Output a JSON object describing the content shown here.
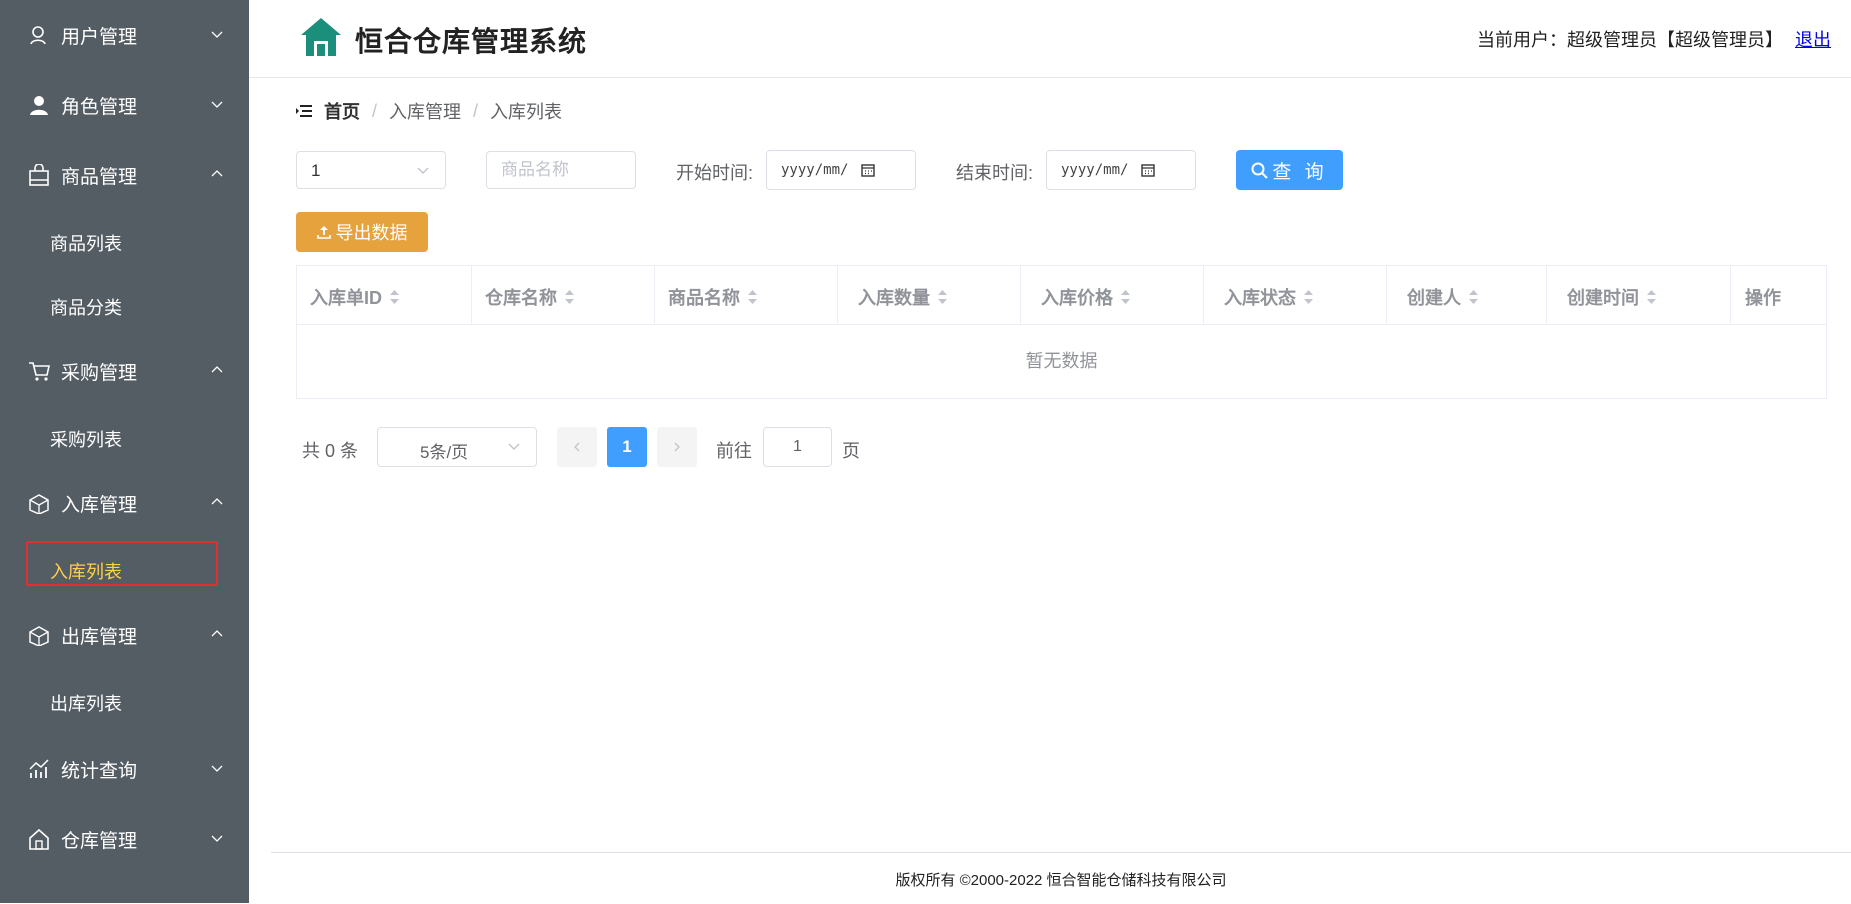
{
  "sidebar": {
    "menus": [
      {
        "label": "用户管理",
        "icon": "user-outline-icon",
        "expanded": false
      },
      {
        "label": "角色管理",
        "icon": "user-solid-icon",
        "expanded": false
      },
      {
        "label": "商品管理",
        "icon": "shopping-bag-icon",
        "expanded": true,
        "children": [
          "商品列表",
          "商品分类"
        ]
      },
      {
        "label": "采购管理",
        "icon": "cart-icon",
        "expanded": true,
        "children": [
          "采购列表"
        ]
      },
      {
        "label": "入库管理",
        "icon": "box-in-icon",
        "expanded": true,
        "children": [
          "入库列表"
        ]
      },
      {
        "label": "出库管理",
        "icon": "box-out-icon",
        "expanded": true,
        "children": [
          "出库列表"
        ]
      },
      {
        "label": "统计查询",
        "icon": "chart-icon",
        "expanded": false
      },
      {
        "label": "仓库管理",
        "icon": "warehouse-icon",
        "expanded": false
      }
    ],
    "active_item": "入库列表",
    "colors": {
      "bg": "#545c64",
      "text": "#ffffff",
      "active": "#ffd04b",
      "highlight_box": "#e03131"
    }
  },
  "header": {
    "title": "恒合仓库管理系统",
    "user_label": "当前用户：超级管理员【超级管理员】",
    "logout": "退出",
    "logo_color": "#1b8f7c"
  },
  "breadcrumb": {
    "home": "首页",
    "level1": "入库管理",
    "level2": "入库列表"
  },
  "filters": {
    "warehouse_value": "1",
    "name_placeholder": "商品名称",
    "start_label": "开始时间:",
    "start_value": "yyyy/mm/",
    "end_label": "结束时间:",
    "end_value": "yyyy/mm/",
    "query_label": "查 询"
  },
  "export_label": "导出数据",
  "table": {
    "columns": [
      "入库单ID",
      "仓库名称",
      "商品名称",
      "入库数量",
      "入库价格",
      "入库状态",
      "创建人",
      "创建时间",
      "操作"
    ],
    "sortable": [
      true,
      true,
      true,
      true,
      true,
      true,
      true,
      true,
      false
    ],
    "empty_text": "暂无数据"
  },
  "pagination": {
    "total": "共 0 条",
    "page_size": "5条/页",
    "current": "1",
    "goto_label": "前往",
    "goto_value": "1",
    "page_suffix": "页"
  },
  "footer": "版权所有 ©2000-2022  恒合智能仓储科技有限公司"
}
